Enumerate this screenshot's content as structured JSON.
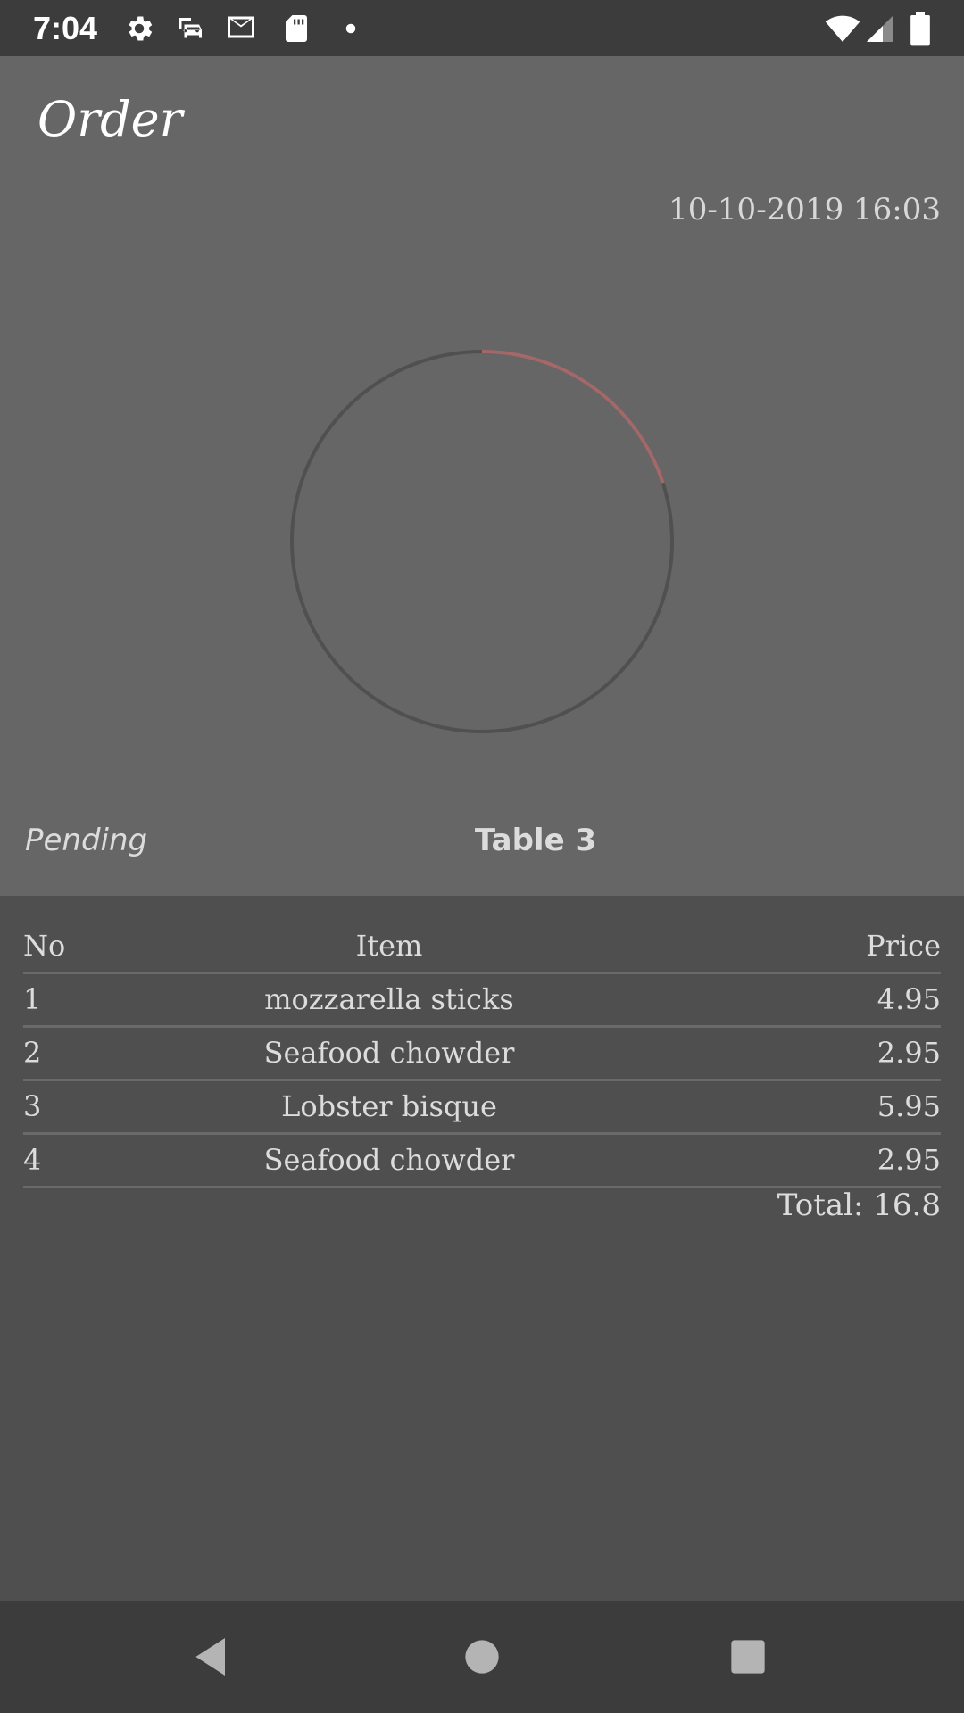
{
  "status_bar": {
    "time": "7:04",
    "left_icons": [
      "gear-icon",
      "car-icon",
      "mail-icon",
      "sd-card-icon",
      "dot-icon"
    ],
    "right_icons": [
      "wifi-icon",
      "signal-icon",
      "battery-icon"
    ]
  },
  "header": {
    "title": "Order",
    "datetime": "10-10-2019 16:03",
    "status": "Pending",
    "table": "Table 3",
    "progress": 0.2,
    "colors": {
      "background": "#666666",
      "ring_track": "#505050",
      "ring_progress": "#a36868"
    }
  },
  "order": {
    "columns": {
      "no": "No",
      "item": "Item",
      "price": "Price"
    },
    "rows": [
      {
        "no": "1",
        "item": "mozzarella sticks",
        "price": "4.95"
      },
      {
        "no": "2",
        "item": "Seafood chowder",
        "price": "2.95"
      },
      {
        "no": "3",
        "item": "Lobster bisque",
        "price": "5.95"
      },
      {
        "no": "4",
        "item": "Seafood chowder",
        "price": "2.95"
      }
    ],
    "total": "Total: 16.8"
  },
  "nav_bar": {
    "icons": [
      "back-icon",
      "home-icon",
      "recents-icon"
    ]
  }
}
